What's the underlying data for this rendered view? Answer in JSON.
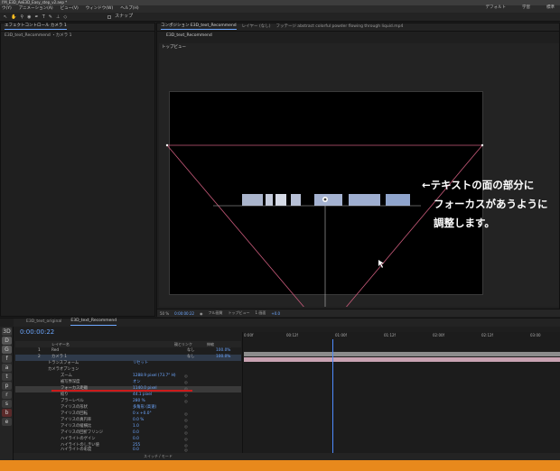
{
  "window": {
    "title": "I'M_E3D_AeE3D_Easy_step_v2.aep *"
  },
  "menu": [
    "ウ(Y)",
    "アニメーション(A)",
    "ビュー(V)",
    "ウィンドウ(W)",
    "ヘルプ(H)"
  ],
  "workspaces": [
    "デフォルト",
    "学習",
    "標準"
  ],
  "toolbar": {
    "snap_label": "スナップ"
  },
  "project_panel": {
    "tab": "エフェクトコントロール カメラ 1",
    "subtitle": "E3D_text_Recommend ・カメラ 1"
  },
  "comp_panel": {
    "tabs": [
      "コンポジション E3D_text_Recommend",
      "レイヤー (なし)",
      "フッテージ abstract colorful powder flowing through liquid.mp4"
    ],
    "sub_tab": "E3D_text_Recommend",
    "view_label": "トップビュー"
  },
  "viewer_bar": {
    "zoom": "50 %",
    "timecode": "0:00:00:22",
    "quality": "フル画質",
    "view": "トップビュー",
    "views": "1 画面",
    "exposure": "+0.0"
  },
  "annotation": {
    "line1": "←テキストの面の部分に",
    "line2": "フォーカスがあうように",
    "line3": "調整します。"
  },
  "timeline": {
    "tabs": [
      "E3D_text_original",
      "E3D_text_Recommend"
    ],
    "timecode": "0:00:00:22",
    "header": [
      "レイヤー名",
      "親とリンク",
      "伸縮"
    ],
    "layers": [
      {
        "num": "1",
        "name": "Red",
        "parent": "なし",
        "stretch": "100.0%"
      },
      {
        "num": "2",
        "name": "カメラ 1",
        "parent": "なし",
        "stretch": "100.0%"
      }
    ],
    "properties": [
      {
        "name": "トランスフォーム",
        "value": "リセット"
      },
      {
        "name": "カメラオプション",
        "value": ""
      },
      {
        "name": "ズーム",
        "value": "1288.9 pixel (73.7° H)"
      },
      {
        "name": "被写界深度",
        "value": "オン"
      },
      {
        "name": "フォーカス距離",
        "value": "1140.0 pixel"
      },
      {
        "name": "絞り",
        "value": "44.1 pixel"
      },
      {
        "name": "ブラーレベル",
        "value": "280 %"
      },
      {
        "name": "アイリスの形状",
        "value": "多角形 (高速)"
      },
      {
        "name": "アイリスの回転",
        "value": "0 x +0.0°"
      },
      {
        "name": "アイリスの真円率",
        "value": "0.0 %"
      },
      {
        "name": "アイリスの縦横比",
        "value": "1.0"
      },
      {
        "name": "アイリスの回折フリンジ",
        "value": "0.0"
      },
      {
        "name": "ハイライトのゲイン",
        "value": "0.0"
      },
      {
        "name": "ハイライトのしきい値",
        "value": "255"
      },
      {
        "name": "ハイライトの彩度",
        "value": "0.0"
      }
    ],
    "ruler_ticks": [
      "0:00f",
      "00:12f",
      "01:00f",
      "01:12f",
      "02:00f",
      "02:12f",
      "03:00"
    ],
    "footer": "スイッチ / モード"
  },
  "left_icons": [
    "3D",
    "D",
    "G",
    "f",
    "a",
    "t",
    "p",
    "r",
    "s",
    "b",
    "e"
  ],
  "colors": {
    "accent": "#6da7ff",
    "annotation_text": "#ffffff",
    "underline_red": "#cc1a1a",
    "bottom_strip": "#e8891c"
  }
}
